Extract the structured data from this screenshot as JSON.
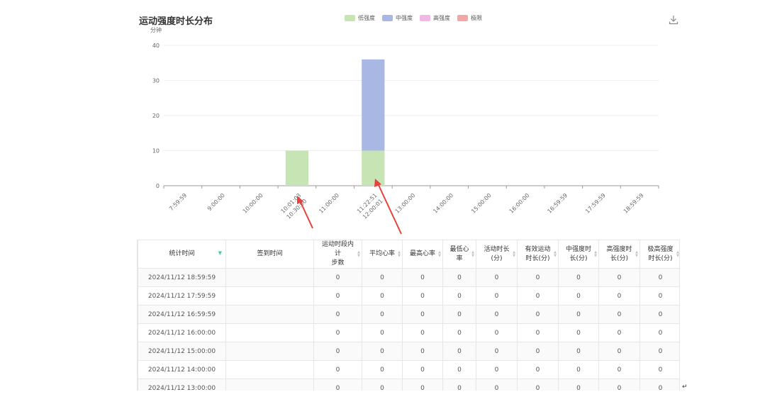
{
  "chart_data": {
    "type": "bar",
    "stacked": true,
    "title": "运动强度时长分布",
    "ylabel": "分钟",
    "ylim": [
      0,
      40
    ],
    "yticks": [
      0,
      10,
      20,
      30,
      40
    ],
    "categories": [
      "7:59:59",
      "9:00:00",
      "10:00:00",
      "10:01:03\n10:30:00",
      "11:00:00",
      "11:22:51\n12:00:01",
      "13:00:00",
      "14:00:00",
      "15:00:00",
      "16:00:00",
      "16:59:59",
      "17:59:59",
      "18:59:59"
    ],
    "series": [
      {
        "name": "低强度",
        "color": "#c6e4b4",
        "values": [
          0,
          0,
          0,
          10,
          0,
          10,
          0,
          0,
          0,
          0,
          0,
          0,
          0
        ]
      },
      {
        "name": "中强度",
        "color": "#a9b7e4",
        "values": [
          0,
          0,
          0,
          0,
          0,
          26,
          0,
          0,
          0,
          0,
          0,
          0,
          0
        ]
      },
      {
        "name": "高强度",
        "color": "#f0b9e4",
        "values": [
          0,
          0,
          0,
          0,
          0,
          0,
          0,
          0,
          0,
          0,
          0,
          0,
          0
        ]
      },
      {
        "name": "极限",
        "color": "#f2a7a7",
        "values": [
          0,
          0,
          0,
          0,
          0,
          0,
          0,
          0,
          0,
          0,
          0,
          0,
          0
        ]
      }
    ],
    "grid": true,
    "legend": "top-center"
  },
  "icons": {
    "download": "download-icon",
    "sort": "sort-caret-icon"
  },
  "annotation_color": "#e8403b",
  "table": {
    "headers": [
      "统计时间",
      "签到时间",
      "运动时段内计步数",
      "平均心率",
      "最高心率",
      "最低心率",
      "活动时长(分)",
      "有效运动时长(分)",
      "中强度时长(分)",
      "高强度时长(分)",
      "极高强度时长(分)"
    ],
    "header_lines": [
      [
        "统计时间"
      ],
      [
        "签到时间"
      ],
      [
        "运动时段内计",
        "步数"
      ],
      [
        "平均心率"
      ],
      [
        "最高心率"
      ],
      [
        "最低心",
        "率"
      ],
      [
        "活动时长",
        "(分)"
      ],
      [
        "有效运动",
        "时长(分)"
      ],
      [
        "中强度时",
        "长(分)"
      ],
      [
        "高强度时",
        "长(分)"
      ],
      [
        "极高强度",
        "时长(分)"
      ]
    ],
    "rows": [
      [
        "2024/11/12 18:59:59",
        "",
        "0",
        "0",
        "0",
        "0",
        "0",
        "0",
        "0",
        "0",
        "0"
      ],
      [
        "2024/11/12 17:59:59",
        "",
        "0",
        "0",
        "0",
        "0",
        "0",
        "0",
        "0",
        "0",
        "0"
      ],
      [
        "2024/11/12 16:59:59",
        "",
        "0",
        "0",
        "0",
        "0",
        "0",
        "0",
        "0",
        "0",
        "0"
      ],
      [
        "2024/11/12 16:00:00",
        "",
        "0",
        "0",
        "0",
        "0",
        "0",
        "0",
        "0",
        "0",
        "0"
      ],
      [
        "2024/11/12 15:00:00",
        "",
        "0",
        "0",
        "0",
        "0",
        "0",
        "0",
        "0",
        "0",
        "0"
      ],
      [
        "2024/11/12 14:00:00",
        "",
        "0",
        "0",
        "0",
        "0",
        "0",
        "0",
        "0",
        "0",
        "0"
      ],
      [
        "2024/11/12 13:00:00",
        "",
        "0",
        "0",
        "0",
        "0",
        "0",
        "0",
        "0",
        "0",
        "0"
      ]
    ]
  }
}
